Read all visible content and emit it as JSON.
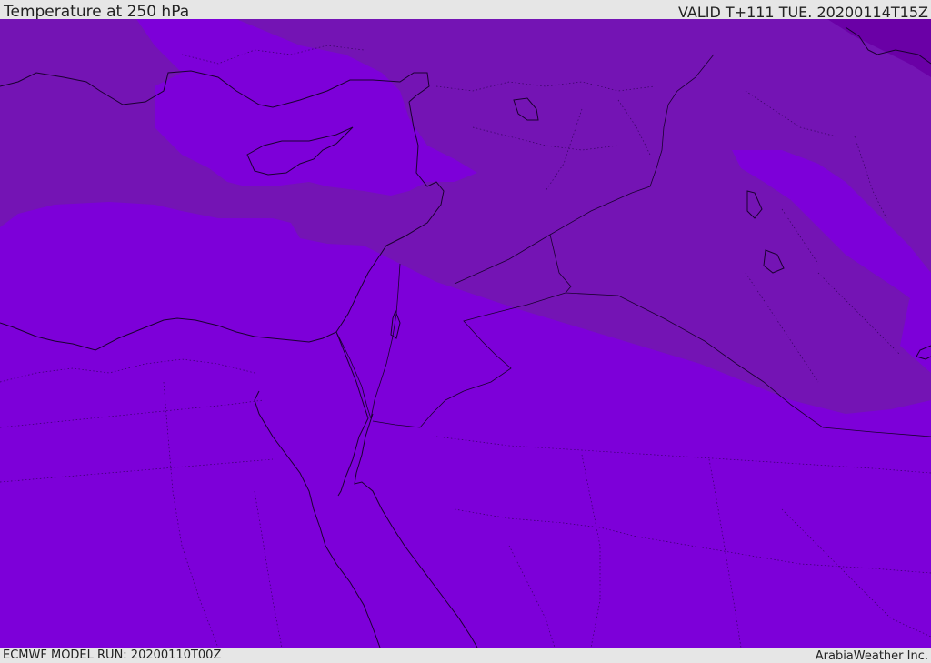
{
  "header": {
    "title": "Temperature at 250 hPa",
    "valid": "VALID T+111 TUE. 20200114T15Z"
  },
  "footer": {
    "model_run": "ECMWF MODEL RUN: 20200110T00Z",
    "credit": "ArabiaWeather Inc."
  },
  "colors": {
    "field_base": "#7d00d9",
    "field_warm": "#7414b4",
    "field_warmest": "#6a00a6",
    "coastline": "#1a0030"
  }
}
